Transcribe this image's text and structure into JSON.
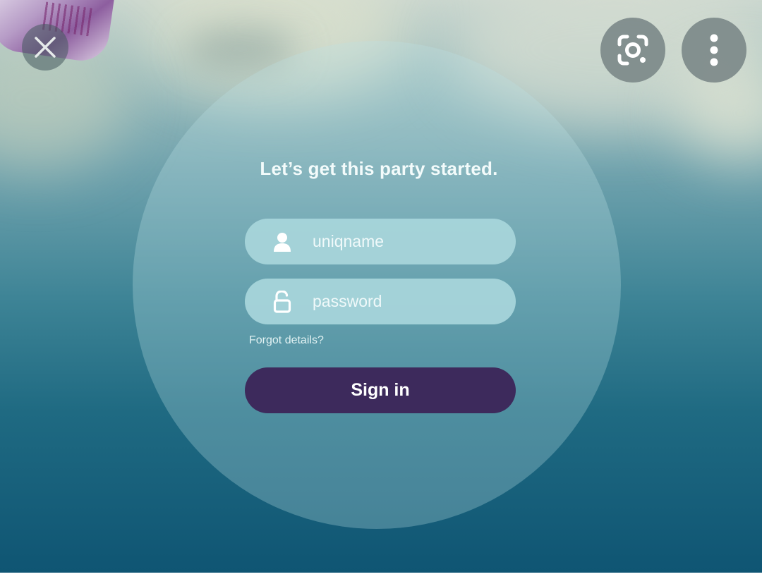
{
  "login": {
    "headline": "Let’s get this party started.",
    "username_placeholder": "uniqname",
    "password_placeholder": "password",
    "forgot_label": "Forgot details?",
    "signin_label": "Sign in"
  },
  "overlay": {
    "close_icon": "close-icon",
    "lens_icon": "lens-search-icon",
    "more_icon": "more-vertical-icon"
  },
  "colors": {
    "signin_button": "#3d2a5c",
    "field_background": "#a8d6db",
    "background_top": "#c9d6cf",
    "background_bottom": "#0f5573"
  }
}
